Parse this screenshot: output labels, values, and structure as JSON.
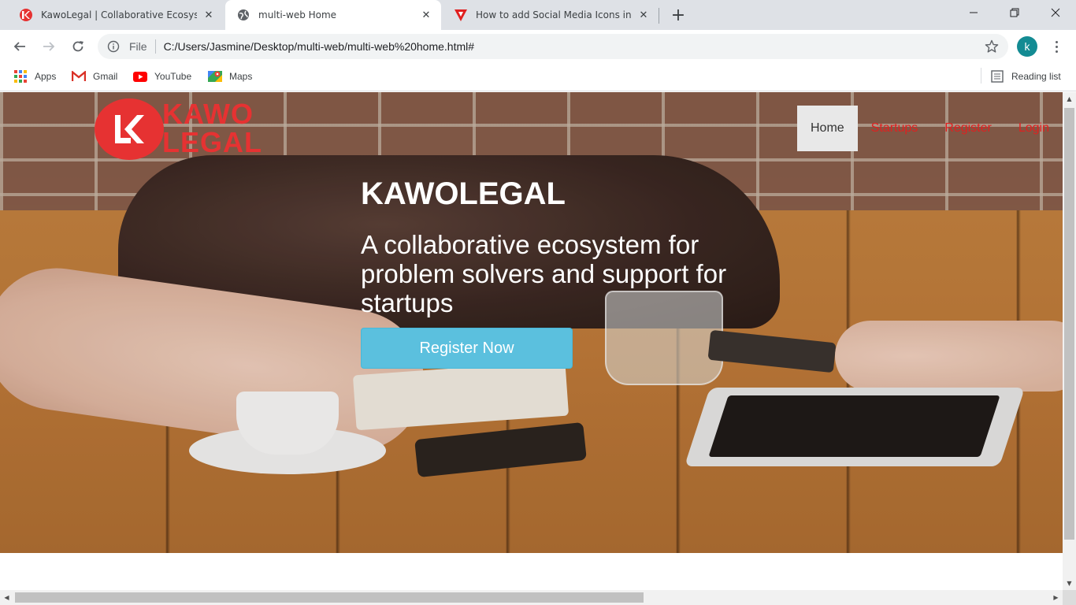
{
  "browser": {
    "tabs": [
      {
        "title": "KawoLegal | Collaborative Ecosystem",
        "favicon": "kawolegal-favicon",
        "active": false
      },
      {
        "title": "multi-web Home",
        "favicon": "globe-icon",
        "active": true
      },
      {
        "title": "How to add Social Media Icons in HTML",
        "favicon": "v-logo-icon",
        "active": false
      }
    ],
    "address": {
      "scheme_label": "File",
      "url": "C:/Users/Jasmine/Desktop/multi-web/multi-web%20home.html#"
    },
    "profile_initial": "k",
    "bookmarks": [
      {
        "label": "Apps",
        "icon": "apps-grid-icon"
      },
      {
        "label": "Gmail",
        "icon": "gmail-icon"
      },
      {
        "label": "YouTube",
        "icon": "youtube-icon"
      },
      {
        "label": "Maps",
        "icon": "maps-icon"
      }
    ],
    "reading_list": "Reading list"
  },
  "site": {
    "logo": {
      "line1": "KAWO",
      "line2": "LEGAL",
      "mark": "LK"
    },
    "nav": [
      {
        "label": "Home",
        "active": true
      },
      {
        "label": "Startups",
        "active": false
      },
      {
        "label": "Register",
        "active": false
      },
      {
        "label": "Login",
        "active": false
      }
    ],
    "hero": {
      "title": "KAWOLEGAL",
      "subtitle": "A collaborative ecosystem for problem solvers and support for startups",
      "cta": "Register Now"
    }
  },
  "colors": {
    "brand_red": "#e63232",
    "cta_blue": "#5bc0de",
    "profile": "#138b93"
  }
}
